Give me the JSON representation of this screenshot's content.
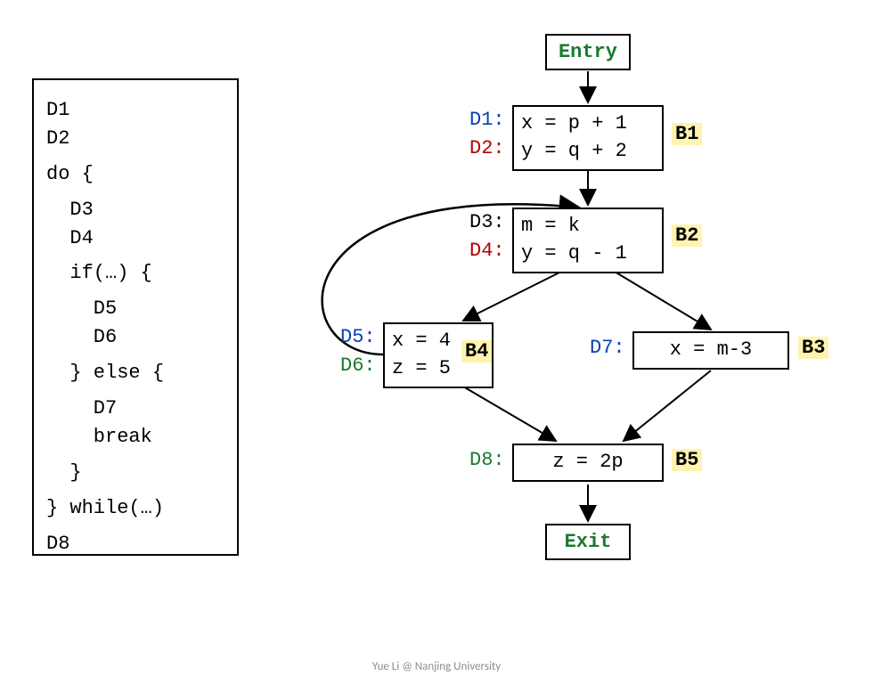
{
  "code": {
    "l1": "D1",
    "l2": "D2",
    "l3": "do {",
    "l4": "  D3",
    "l5": "  D4",
    "l6": "  if(…) {",
    "l7": "    D5",
    "l8": "    D6",
    "l9": "  } else {",
    "l10": "    D7",
    "l11": "    break",
    "l12": "  }",
    "l13": "} while(…)",
    "l14": "D8"
  },
  "cfg": {
    "entry": "Entry",
    "exit": "Exit",
    "b1": {
      "label": "B1",
      "d1_lbl": "D1:",
      "d1_code": "x = p + 1",
      "d2_lbl": "D2:",
      "d2_code": "y = q + 2"
    },
    "b2": {
      "label": "B2",
      "d3_lbl": "D3:",
      "d3_code": "m = k",
      "d4_lbl": "D4:",
      "d4_code": "y = q - 1"
    },
    "b4": {
      "label": "B4",
      "d5_lbl": "D5:",
      "d5_code": "x = 4",
      "d6_lbl": "D6:",
      "d6_code": "z = 5"
    },
    "b3": {
      "label": "B3",
      "d7_lbl": "D7:",
      "d7_code": "x = m-3"
    },
    "b5": {
      "label": "B5",
      "d8_lbl": "D8:",
      "d8_code": "z = 2p"
    }
  },
  "footer": "Yue Li @ Nanjing University"
}
